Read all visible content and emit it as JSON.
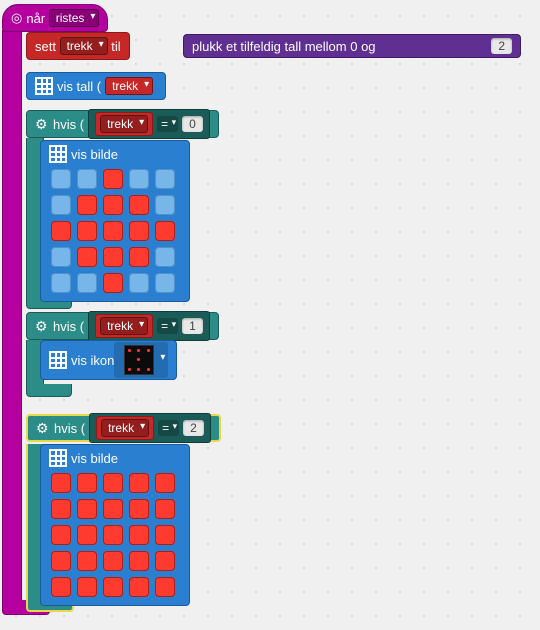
{
  "event": {
    "label": "når",
    "gesture": "ristes",
    "icon": "target-icon"
  },
  "setBlock": {
    "label_set": "sett",
    "variable": "trekk",
    "label_to": "til"
  },
  "randomBlock": {
    "label_pick": "plukk et tilfeldig tall mellom 0 og",
    "max": "2"
  },
  "showNumber": {
    "label": "vis tall",
    "variable": "trekk"
  },
  "if1": {
    "label": "hvis",
    "variable": "trekk",
    "op": "=",
    "value": "0"
  },
  "showImage1": {
    "label": "vis bilde",
    "grid": [
      [
        0,
        0,
        1,
        0,
        0
      ],
      [
        0,
        1,
        1,
        1,
        0
      ],
      [
        1,
        1,
        1,
        1,
        1
      ],
      [
        0,
        1,
        1,
        1,
        0
      ],
      [
        0,
        0,
        1,
        0,
        0
      ]
    ]
  },
  "if2": {
    "label": "hvis",
    "variable": "trekk",
    "op": "=",
    "value": "1"
  },
  "showIcon": {
    "label": "vis ikon",
    "icon_name": "chessboard-icon"
  },
  "if3": {
    "label": "hvis",
    "variable": "trekk",
    "op": "=",
    "value": "2"
  },
  "showImage2": {
    "label": "vis bilde",
    "grid": [
      [
        1,
        1,
        1,
        1,
        1
      ],
      [
        1,
        1,
        1,
        1,
        1
      ],
      [
        1,
        1,
        1,
        1,
        1
      ],
      [
        1,
        1,
        1,
        1,
        1
      ],
      [
        1,
        1,
        1,
        1,
        1
      ]
    ]
  }
}
